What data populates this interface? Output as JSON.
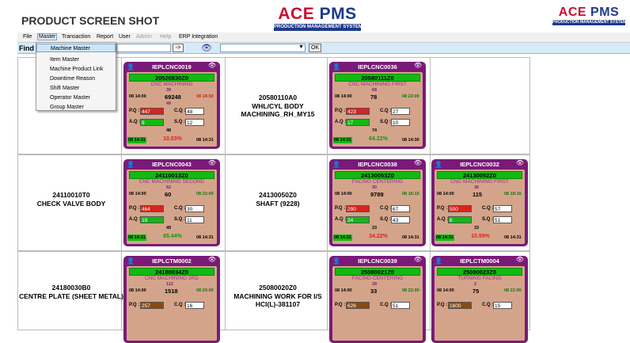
{
  "header": {
    "title": "PRODUCT SCREEN SHOT",
    "logo_main": {
      "ace": "ACE",
      "pms": "PMS"
    },
    "logo_sub": "PRODUCTION MANAGEMENT SYSTEM"
  },
  "menubar": [
    "File",
    "Master",
    "Transaction",
    "Report",
    "User",
    "Admin",
    "Help",
    "ERP Integration"
  ],
  "master_menu": [
    "Machine Master",
    "Item Master",
    "Machine Product Link",
    "Downtime Reason",
    "Shift Master",
    "Operator Master",
    "Group Master"
  ],
  "find": {
    "label": "Find",
    "go": "->",
    "ok": "OK"
  },
  "rows": [
    {
      "products": [
        {
          "code": "",
          "name": ""
        },
        {
          "code": "20580110A0",
          "name": "WHL/CYL BODY MACHINING_RH_MY15"
        }
      ],
      "cards": [
        {
          "machine": "IEPLCNC0019",
          "prod": "20520830Z0",
          "process": "CNC MACHINING",
          "n1": "39",
          "t1": "08 14:00",
          "plan": "69248",
          "t2": "08 18:50",
          "n2": "49",
          "pq": "447",
          "cq": "48",
          "aq": "8",
          "sq": "12",
          "n3": "48",
          "tl": "08 14:31",
          "pct": "10.83%",
          "tr": "08 14:31",
          "pctc": "r"
        },
        {
          "machine": "IEPLCNC0036",
          "prod": "20580111Z0",
          "process": "CNC MACHINING FIRST",
          "n1": "68",
          "t1": "08 14:00",
          "plan": "78",
          "t2": "08 22:00",
          "n2": "",
          "pq": "423",
          "cq": "27",
          "aq": "17",
          "sq": "10",
          "n3": "74",
          "tl": "08 14:31",
          "pct": "64.22%",
          "tr": "08 14:30",
          "pctc": "g"
        }
      ]
    },
    {
      "products": [
        {
          "code": "24110010T0",
          "name": "CHECK VALVE BODY"
        },
        {
          "code": "24130050Z0",
          "name": "SHAFT (9228)"
        }
      ],
      "cards": [
        {
          "machine": "IEPLCNC0043",
          "prod": "24110013Z0",
          "process": "CNC MACHINING SECOND",
          "n1": "62",
          "t1": "08 14:00",
          "plan": "60",
          "t2": "08 22:00",
          "n2": "",
          "pq": "464",
          "cq": "30",
          "aq": "19",
          "sq": "11",
          "n3": "49",
          "tl": "08 14:31",
          "pct": "65.44%",
          "tr": "08 14:31",
          "pctc": "g"
        },
        {
          "machine": "IEPLCNC0038",
          "prod": "24130053Z0",
          "process": "FACING CENTERING",
          "n1": "30",
          "t1": "08 14:00",
          "plan": "9789",
          "t2": "08 16:15",
          "n2": "",
          "pq": "290",
          "cq": "67",
          "aq": "24",
          "sq": "43",
          "n3": "23",
          "tl": "08 14:31",
          "pct": "34.22%",
          "tr": "08 14:31",
          "pctc": "r"
        },
        {
          "machine": "IEPLCNC0032",
          "prod": "24130052Z0",
          "process": "CNC MACHINING FIRST",
          "n1": "36",
          "t1": "08 14:00",
          "plan": "115",
          "t2": "08 18:15",
          "n2": "",
          "pq": "500",
          "cq": "57",
          "aq": "6",
          "sq": "51",
          "n3": "33",
          "tl": "08 14:31",
          "pct": "10.99%",
          "tr": "08 14:31",
          "pctc": "r"
        }
      ]
    },
    {
      "products": [
        {
          "code": "24180030B0",
          "name": "CENTRE PLATE (SHEET METAL)"
        },
        {
          "code": "25080020Z0",
          "name": "MACHINING WORK FOR I/S HCI(L)-381107"
        }
      ],
      "cards": [
        {
          "machine": "IEPLCTM0002",
          "prod": "24180034Z0",
          "process": "CNC MACHINING 3RD",
          "n1": "112",
          "t1": "08 14:00",
          "plan": "1518",
          "t2": "08 20:00",
          "pq": "257",
          "cq": "16"
        },
        {
          "machine": "IEPLCNC0039",
          "prod": "25080021Z0",
          "process": "FACING CENTERING",
          "n1": "39",
          "t1": "08 14:00",
          "plan": "33",
          "t2": "08 22:00",
          "pq": "626",
          "cq": "51"
        },
        {
          "machine": "IEPLCTM0004",
          "prod": "25080023Z0",
          "process": "TURNING FACING",
          "n1": "2",
          "t1": "08 14:00",
          "plan": "75",
          "t2": "08 22:00",
          "pq": "1600",
          "cq": "15"
        }
      ]
    }
  ],
  "colors": {
    "card_bg": "#7a1a78",
    "card_body": "#d4a48a",
    "green": "#13b913",
    "red": "#d8241c",
    "brown": "#8b4a12",
    "logo_red": "#c8102e",
    "logo_blue": "#1d3a8a"
  },
  "icons": {
    "user": "user-icon",
    "eye": "eye-icon"
  }
}
